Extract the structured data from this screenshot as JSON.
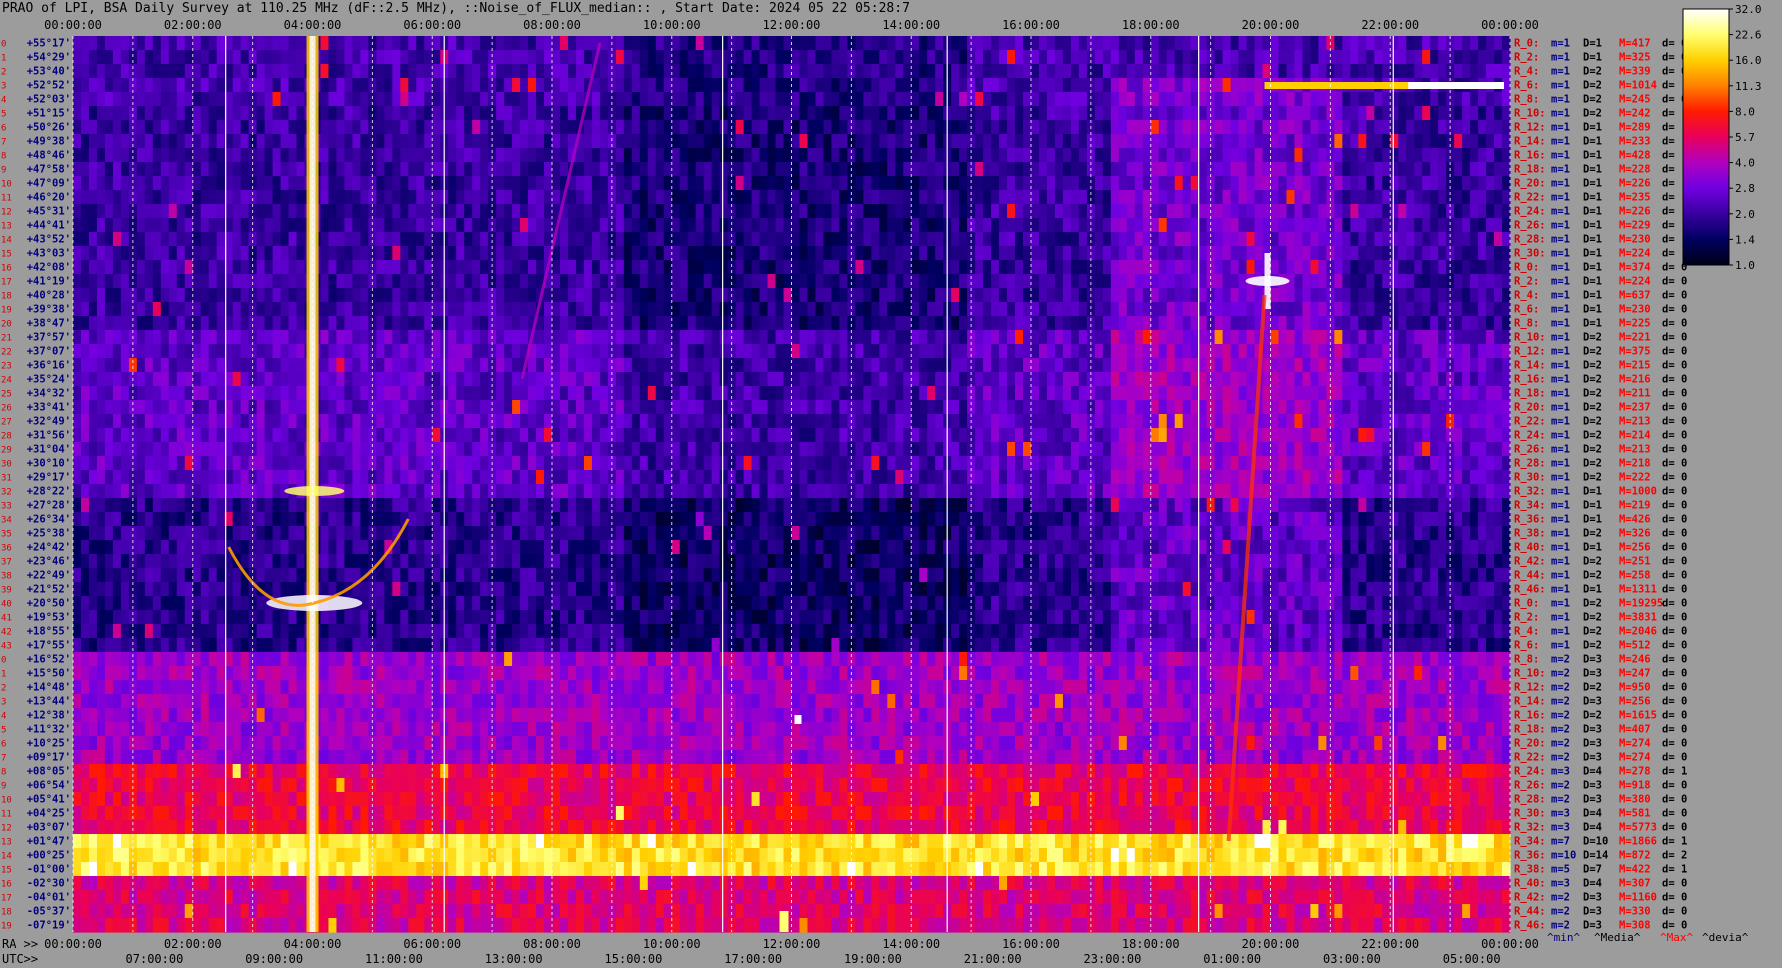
{
  "title": "PRAO of LPI, BSA Daily Survey at 110.25 MHz (dF::2.5 MHz), ::Noise_of_FLUX_median:: , Start Date: 2024 05 22 05:28:7",
  "chart_data": {
    "type": "heatmap",
    "title": "PRAO of LPI, BSA Daily Survey at 110.25 MHz (dF::2.5 MHz), ::Noise_of_FLUX_median:: , Start Date: 2024 05 22 05:28:7",
    "ra_ticks": [
      "00:00:00",
      "02:00:00",
      "04:00:00",
      "06:00:00",
      "08:00:00",
      "10:00:00",
      "12:00:00",
      "14:00:00",
      "16:00:00",
      "18:00:00",
      "20:00:00",
      "22:00:00",
      "00:00:00"
    ],
    "ra_axis_label": "RA >>",
    "utc_axis_label": "UTC>>",
    "utc_ticks": [
      "07:00:00",
      "09:00:00",
      "11:00:00",
      "13:00:00",
      "15:00:00",
      "17:00:00",
      "19:00:00",
      "21:00:00",
      "23:00:00",
      "01:00:00",
      "03:00:00",
      "05:00:00"
    ],
    "dec_ticks": [
      "+55°17'",
      "+54°29'",
      "+53°40'",
      "+52°52'",
      "+52°03'",
      "+51°15'",
      "+50°26'",
      "+49°38'",
      "+48°46'",
      "+47°58'",
      "+47°09'",
      "+46°20'",
      "+45°31'",
      "+44°41'",
      "+43°52'",
      "+43°03'",
      "+42°08'",
      "+41°19'",
      "+40°28'",
      "+39°38'",
      "+38°47'",
      "+37°57'",
      "+37°07'",
      "+36°16'",
      "+35°24'",
      "+34°32'",
      "+33°41'",
      "+32°49'",
      "+31°56'",
      "+31°04'",
      "+30°10'",
      "+29°17'",
      "+28°22'",
      "+27°28'",
      "+26°34'",
      "+25°38'",
      "+24°42'",
      "+23°46'",
      "+22°49'",
      "+21°52'",
      "+20°50'",
      "+19°53'",
      "+18°55'",
      "+17°55'",
      "+16°52'",
      "+15°50'",
      "+14°48'",
      "+13°44'",
      "+12°38'",
      "+11°32'",
      "+10°25'",
      "+09°17'",
      "+08°05'",
      "+06°54'",
      "+05°41'",
      "+04°25'",
      "+03°07'",
      "+01°47'",
      "+00°25'",
      "-01°00'",
      "-02°30'",
      "-04°01'",
      "-05°37'",
      "-07°19'"
    ],
    "colorbar": {
      "ticks": [
        "32.0",
        "22.6",
        "16.0",
        "11.3",
        "8.0",
        "5.7",
        "4.0",
        "2.8",
        "2.0",
        "1.4",
        "1.0"
      ],
      "colors": [
        "#ffffff",
        "#ffff70",
        "#ffd000",
        "#ff8000",
        "#ff1a00",
        "#e8005c",
        "#b000c0",
        "#7000e0",
        "#3800a0",
        "#000060",
        "#000018"
      ]
    },
    "rows": [
      {
        "r": "R_0:",
        "m": "m=1",
        "D": "D=1",
        "M": "M=417",
        "d": "d= 0"
      },
      {
        "r": "R_2:",
        "m": "m=1",
        "D": "D=1",
        "M": "M=325",
        "d": "d= 0"
      },
      {
        "r": "R_4:",
        "m": "m=1",
        "D": "D=2",
        "M": "M=339",
        "d": "d= 0"
      },
      {
        "r": "R_6:",
        "m": "m=1",
        "D": "D=2",
        "M": "M=1014",
        "d": "d="
      },
      {
        "r": "R_8:",
        "m": "m=1",
        "D": "D=2",
        "M": "M=245",
        "d": "d= 0"
      },
      {
        "r": "R_10:",
        "m": "m=1",
        "D": "D=2",
        "M": "M=242",
        "d": "d="
      },
      {
        "r": "R_12:",
        "m": "m=1",
        "D": "D=1",
        "M": "M=289",
        "d": "d="
      },
      {
        "r": "R_14:",
        "m": "m=1",
        "D": "D=1",
        "M": "M=233",
        "d": "d="
      },
      {
        "r": "R_16:",
        "m": "m=1",
        "D": "D=1",
        "M": "M=428",
        "d": "d="
      },
      {
        "r": "R_18:",
        "m": "m=1",
        "D": "D=1",
        "M": "M=228",
        "d": "d="
      },
      {
        "r": "R_20:",
        "m": "m=1",
        "D": "D=1",
        "M": "M=226",
        "d": "d="
      },
      {
        "r": "R_22:",
        "m": "m=1",
        "D": "D=1",
        "M": "M=235",
        "d": "d="
      },
      {
        "r": "R_24:",
        "m": "m=1",
        "D": "D=1",
        "M": "M=226",
        "d": "d="
      },
      {
        "r": "R_26:",
        "m": "m=1",
        "D": "D=1",
        "M": "M=229",
        "d": "d="
      },
      {
        "r": "R_28:",
        "m": "m=1",
        "D": "D=1",
        "M": "M=230",
        "d": "d="
      },
      {
        "r": "R_30:",
        "m": "m=1",
        "D": "D=1",
        "M": "M=224",
        "d": "d="
      },
      {
        "r": "R_0:",
        "m": "m=1",
        "D": "D=1",
        "M": "M=374",
        "d": "d= 0"
      },
      {
        "r": "R_2:",
        "m": "m=1",
        "D": "D=1",
        "M": "M=224",
        "d": "d= 0"
      },
      {
        "r": "R_4:",
        "m": "m=1",
        "D": "D=1",
        "M": "M=637",
        "d": "d= 0"
      },
      {
        "r": "R_6:",
        "m": "m=1",
        "D": "D=1",
        "M": "M=230",
        "d": "d= 0"
      },
      {
        "r": "R_8:",
        "m": "m=1",
        "D": "D=1",
        "M": "M=225",
        "d": "d= 0"
      },
      {
        "r": "R_10:",
        "m": "m=1",
        "D": "D=2",
        "M": "M=221",
        "d": "d= 0"
      },
      {
        "r": "R_12:",
        "m": "m=1",
        "D": "D=2",
        "M": "M=375",
        "d": "d= 0"
      },
      {
        "r": "R_14:",
        "m": "m=1",
        "D": "D=2",
        "M": "M=215",
        "d": "d= 0"
      },
      {
        "r": "R_16:",
        "m": "m=1",
        "D": "D=2",
        "M": "M=216",
        "d": "d= 0"
      },
      {
        "r": "R_18:",
        "m": "m=1",
        "D": "D=2",
        "M": "M=211",
        "d": "d= 0"
      },
      {
        "r": "R_20:",
        "m": "m=1",
        "D": "D=2",
        "M": "M=237",
        "d": "d= 0"
      },
      {
        "r": "R_22:",
        "m": "m=1",
        "D": "D=2",
        "M": "M=213",
        "d": "d= 0"
      },
      {
        "r": "R_24:",
        "m": "m=1",
        "D": "D=2",
        "M": "M=214",
        "d": "d= 0"
      },
      {
        "r": "R_26:",
        "m": "m=1",
        "D": "D=2",
        "M": "M=213",
        "d": "d= 0"
      },
      {
        "r": "R_28:",
        "m": "m=1",
        "D": "D=2",
        "M": "M=218",
        "d": "d= 0"
      },
      {
        "r": "R_30:",
        "m": "m=1",
        "D": "D=2",
        "M": "M=222",
        "d": "d= 0"
      },
      {
        "r": "R_32:",
        "m": "m=1",
        "D": "D=1",
        "M": "M=1000",
        "d": "d= 0"
      },
      {
        "r": "R_34:",
        "m": "m=1",
        "D": "D=1",
        "M": "M=219",
        "d": "d= 0"
      },
      {
        "r": "R_36:",
        "m": "m=1",
        "D": "D=1",
        "M": "M=426",
        "d": "d= 0"
      },
      {
        "r": "R_38:",
        "m": "m=1",
        "D": "D=2",
        "M": "M=326",
        "d": "d= 0"
      },
      {
        "r": "R_40:",
        "m": "m=1",
        "D": "D=1",
        "M": "M=256",
        "d": "d= 0"
      },
      {
        "r": "R_42:",
        "m": "m=1",
        "D": "D=2",
        "M": "M=251",
        "d": "d= 0"
      },
      {
        "r": "R_44:",
        "m": "m=1",
        "D": "D=2",
        "M": "M=258",
        "d": "d= 0"
      },
      {
        "r": "R_46:",
        "m": "m=1",
        "D": "D=1",
        "M": "M=1311",
        "d": "d= 0"
      },
      {
        "r": "R_0:",
        "m": "m=1",
        "D": "D=2",
        "M": "M=19295",
        "d": "d= 0"
      },
      {
        "r": "R_2:",
        "m": "m=1",
        "D": "D=2",
        "M": "M=3831",
        "d": "d= 0"
      },
      {
        "r": "R_4:",
        "m": "m=1",
        "D": "D=2",
        "M": "M=2046",
        "d": "d= 0"
      },
      {
        "r": "R_6:",
        "m": "m=1",
        "D": "D=2",
        "M": "M=512",
        "d": "d= 0"
      },
      {
        "r": "R_8:",
        "m": "m=2",
        "D": "D=3",
        "M": "M=246",
        "d": "d= 0"
      },
      {
        "r": "R_10:",
        "m": "m=2",
        "D": "D=3",
        "M": "M=247",
        "d": "d= 0"
      },
      {
        "r": "R_12:",
        "m": "m=2",
        "D": "D=2",
        "M": "M=950",
        "d": "d= 0"
      },
      {
        "r": "R_14:",
        "m": "m=2",
        "D": "D=3",
        "M": "M=256",
        "d": "d= 0"
      },
      {
        "r": "R_16:",
        "m": "m=2",
        "D": "D=2",
        "M": "M=1615",
        "d": "d= 0"
      },
      {
        "r": "R_18:",
        "m": "m=2",
        "D": "D=3",
        "M": "M=407",
        "d": "d= 0"
      },
      {
        "r": "R_20:",
        "m": "m=2",
        "D": "D=3",
        "M": "M=274",
        "d": "d= 0"
      },
      {
        "r": "R_22:",
        "m": "m=2",
        "D": "D=3",
        "M": "M=274",
        "d": "d= 0"
      },
      {
        "r": "R_24:",
        "m": "m=3",
        "D": "D=4",
        "M": "M=278",
        "d": "d= 1"
      },
      {
        "r": "R_26:",
        "m": "m=2",
        "D": "D=3",
        "M": "M=918",
        "d": "d= 0"
      },
      {
        "r": "R_28:",
        "m": "m=2",
        "D": "D=3",
        "M": "M=380",
        "d": "d= 0"
      },
      {
        "r": "R_30:",
        "m": "m=3",
        "D": "D=4",
        "M": "M=581",
        "d": "d= 0"
      },
      {
        "r": "R_32:",
        "m": "m=3",
        "D": "D=4",
        "M": "M=5773",
        "d": "d= 0"
      },
      {
        "r": "R_34:",
        "m": "m=7",
        "D": "D=10",
        "M": "M=1866",
        "d": "d= 1"
      },
      {
        "r": "R_36:",
        "m": "m=10",
        "D": "D=14",
        "M": "M=872",
        "d": "d= 2"
      },
      {
        "r": "R_38:",
        "m": "m=5",
        "D": "D=7",
        "M": "M=422",
        "d": "d= 1"
      },
      {
        "r": "R_40:",
        "m": "m=3",
        "D": "D=4",
        "M": "M=307",
        "d": "d= 0"
      },
      {
        "r": "R_42:",
        "m": "m=2",
        "D": "D=3",
        "M": "M=1160",
        "d": "d= 0"
      },
      {
        "r": "R_44:",
        "m": "m=2",
        "D": "D=3",
        "M": "M=330",
        "d": "d= 0"
      },
      {
        "r": "R_46:",
        "m": "m=2",
        "D": "D=3",
        "M": "M=308",
        "d": "d= 0"
      }
    ],
    "legend_keys": {
      "min": "^min^",
      "median": "^Media^",
      "max": "^Max^",
      "devia": "^devia^"
    },
    "colors": {
      "background": "#9c9c9c",
      "row_label": "#d40000",
      "stat_label": "#000080",
      "max_label": "#ff0000"
    }
  }
}
